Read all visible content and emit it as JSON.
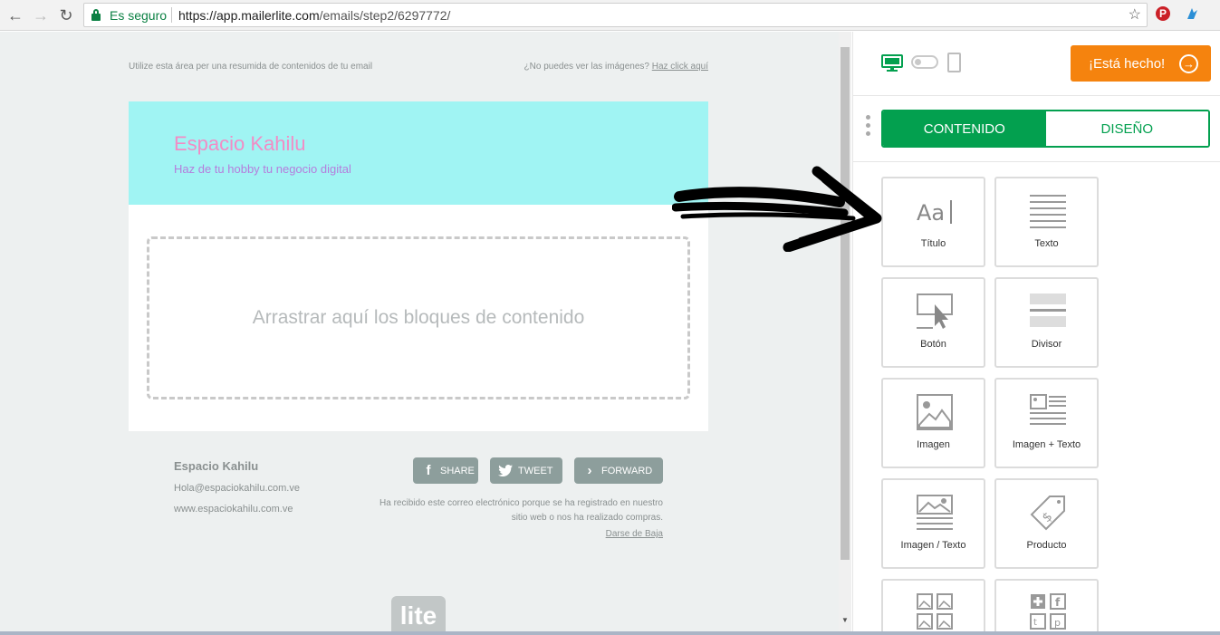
{
  "browser": {
    "secure_label": "Es seguro",
    "url_host": "https://app.mailerlite.com",
    "url_path": "/emails/step2/6297772/"
  },
  "email": {
    "preheader": "Utilize esta área per una resumida de contenidos de tu email",
    "view_text": "¿No puedes ver las imágenes?",
    "view_link": "Haz click aquí",
    "brand_title": "Espacio Kahilu",
    "brand_subtitle": "Haz de tu hobby tu negocio digital",
    "dropzone_text": "Arrastrar aquí los bloques de contenido",
    "footer": {
      "company": "Espacio Kahilu",
      "email": "Hola@espaciokahilu.com.ve",
      "website": "www.espaciokahilu.com.ve",
      "share": "SHARE",
      "tweet": "TWEET",
      "forward": "FORWARD",
      "note": "Ha recibido este correo electrónico porque se ha registrado en nuestro sitio web o nos ha realizado compras.",
      "unsubscribe": "Darse de Baja"
    },
    "badge": "lite"
  },
  "panel": {
    "done_button": "¡Está hecho!",
    "tabs": [
      {
        "label": "CONTENIDO",
        "active": true
      },
      {
        "label": "DISEÑO",
        "active": false
      }
    ],
    "blocks": [
      {
        "label": "Título",
        "icon": "title-icon"
      },
      {
        "label": "Texto",
        "icon": "text-icon"
      },
      {
        "label": "Botón",
        "icon": "button-icon"
      },
      {
        "label": "Divisor",
        "icon": "divider-icon"
      },
      {
        "label": "Imagen",
        "icon": "image-icon"
      },
      {
        "label": "Imagen + Texto",
        "icon": "image-text-icon"
      },
      {
        "label": "Imagen / Texto",
        "icon": "image-over-text-icon"
      },
      {
        "label": "Producto",
        "icon": "product-tag-icon"
      },
      {
        "label": "",
        "icon": "gallery-icon"
      },
      {
        "label": "",
        "icon": "social-icon"
      }
    ]
  },
  "colors": {
    "accent_green": "#03a04f",
    "done_orange": "#f5830e",
    "header_bg": "#a0f4f3",
    "brand_pink": "#f28cc5",
    "brand_purple": "#b57ddc"
  }
}
